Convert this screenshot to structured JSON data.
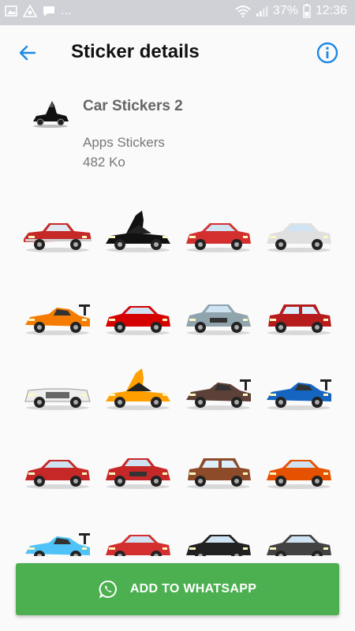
{
  "status_bar": {
    "left_icons": [
      "image-icon",
      "vpn-icon",
      "chat-icon"
    ],
    "more": "...",
    "battery": "37%",
    "time": "12:36"
  },
  "header": {
    "title": "Sticker details",
    "back_icon": "arrow-left-icon",
    "info_icon": "info-icon"
  },
  "pack": {
    "name": "Car Stickers 2",
    "publisher": "Apps Stickers",
    "size": "482 Ko"
  },
  "stickers": [
    {
      "kind": "classic",
      "color": "#c62828"
    },
    {
      "kind": "supercar-open",
      "color": "#111111"
    },
    {
      "kind": "sedan",
      "color": "#d32f2f"
    },
    {
      "kind": "sport",
      "color": "#e0e0e0"
    },
    {
      "kind": "race",
      "color": "#f57c00"
    },
    {
      "kind": "sport",
      "color": "#d50000"
    },
    {
      "kind": "coupe-front",
      "color": "#90a4ae"
    },
    {
      "kind": "suv",
      "color": "#b71c1c"
    },
    {
      "kind": "convertible",
      "color": "#eeeeee"
    },
    {
      "kind": "supercar-open",
      "color": "#ffa000"
    },
    {
      "kind": "race",
      "color": "#5d4037"
    },
    {
      "kind": "race",
      "color": "#1565c0"
    },
    {
      "kind": "sedan",
      "color": "#c62828"
    },
    {
      "kind": "muscle",
      "color": "#c62828"
    },
    {
      "kind": "suv",
      "color": "#8d4b2a"
    },
    {
      "kind": "sport",
      "color": "#e65100"
    },
    {
      "kind": "race",
      "color": "#4fc3f7"
    },
    {
      "kind": "sedan",
      "color": "#d32f2f"
    },
    {
      "kind": "sport",
      "color": "#212121"
    },
    {
      "kind": "sport",
      "color": "#424242"
    }
  ],
  "add_button": {
    "label": "ADD TO WHATSAPP",
    "icon": "whatsapp-icon",
    "color": "#4caf50"
  },
  "accent_color": "#1e88e5"
}
